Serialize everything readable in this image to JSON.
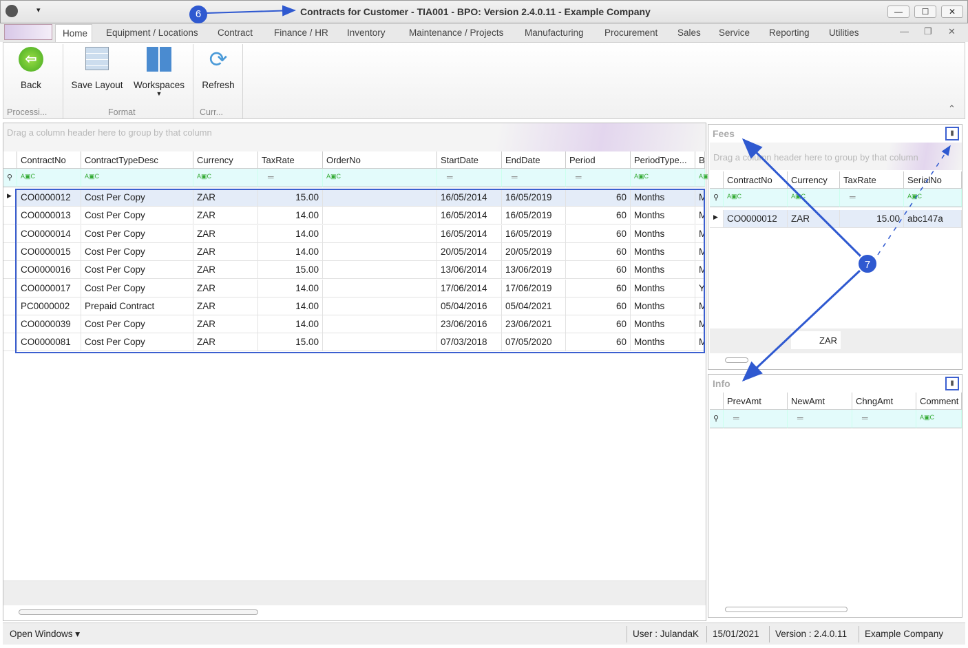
{
  "window": {
    "title": "Contracts for Customer - TIA001 - BPO: Version 2.4.0.11 - Example Company",
    "controls": [
      "—",
      "☐",
      "✕"
    ]
  },
  "tabs": [
    "Home",
    "Equipment / Locations",
    "Contract",
    "Finance / HR",
    "Inventory",
    "Maintenance / Projects",
    "Manufacturing",
    "Procurement",
    "Sales",
    "Service",
    "Reporting",
    "Utilities"
  ],
  "ribbon": {
    "back": "Back",
    "save_layout": "Save Layout",
    "workspaces": "Workspaces",
    "refresh": "Refresh",
    "groups": [
      "Processi...",
      "Format",
      "Curr..."
    ]
  },
  "main_grid": {
    "group_hint": "Drag a column header here to group by that column",
    "columns": [
      "ContractNo",
      "ContractTypeDesc",
      "Currency",
      "TaxRate",
      "OrderNo",
      "StartDate",
      "EndDate",
      "Period",
      "PeriodType...",
      "Bi"
    ],
    "rows": [
      [
        "CO0000012",
        "Cost Per Copy",
        "ZAR",
        "15.00",
        "",
        "16/05/2014",
        "16/05/2019",
        "60",
        "Months",
        "M"
      ],
      [
        "CO0000013",
        "Cost Per Copy",
        "ZAR",
        "14.00",
        "",
        "16/05/2014",
        "16/05/2019",
        "60",
        "Months",
        "M"
      ],
      [
        "CO0000014",
        "Cost Per Copy",
        "ZAR",
        "14.00",
        "",
        "16/05/2014",
        "16/05/2019",
        "60",
        "Months",
        "M"
      ],
      [
        "CO0000015",
        "Cost Per Copy",
        "ZAR",
        "14.00",
        "",
        "20/05/2014",
        "20/05/2019",
        "60",
        "Months",
        "M"
      ],
      [
        "CO0000016",
        "Cost Per Copy",
        "ZAR",
        "15.00",
        "",
        "13/06/2014",
        "13/06/2019",
        "60",
        "Months",
        "M"
      ],
      [
        "CO0000017",
        "Cost Per Copy",
        "ZAR",
        "14.00",
        "",
        "17/06/2014",
        "17/06/2019",
        "60",
        "Months",
        "Y"
      ],
      [
        "PC0000002",
        "Prepaid Contract",
        "ZAR",
        "14.00",
        "",
        "05/04/2016",
        "05/04/2021",
        "60",
        "Months",
        "M"
      ],
      [
        "CO0000039",
        "Cost Per Copy",
        "ZAR",
        "14.00",
        "",
        "23/06/2016",
        "23/06/2021",
        "60",
        "Months",
        "M"
      ],
      [
        "CO0000081",
        "Cost Per Copy",
        "ZAR",
        "15.00",
        "",
        "07/03/2018",
        "07/05/2020",
        "60",
        "Months",
        "M"
      ]
    ]
  },
  "fees": {
    "title": "Fees",
    "group_hint": "Drag a column header here to group by that column",
    "columns": [
      "ContractNo",
      "Currency",
      "TaxRate",
      "SerialNo"
    ],
    "rows": [
      [
        "CO0000012",
        "ZAR",
        "15.00",
        "abc147a"
      ]
    ],
    "footer": "ZAR"
  },
  "info": {
    "title": "Info",
    "columns": [
      "PrevAmt",
      "NewAmt",
      "ChngAmt",
      "Comment"
    ]
  },
  "status": {
    "open_windows": "Open Windows",
    "user": "User : JulandaK",
    "date": "15/01/2021",
    "version": "Version : 2.4.0.11",
    "company": "Example Company"
  },
  "annotations": [
    "6",
    "7"
  ],
  "colors": {
    "accent": "#2f59d0",
    "filter_row": "#e3fbfb"
  }
}
